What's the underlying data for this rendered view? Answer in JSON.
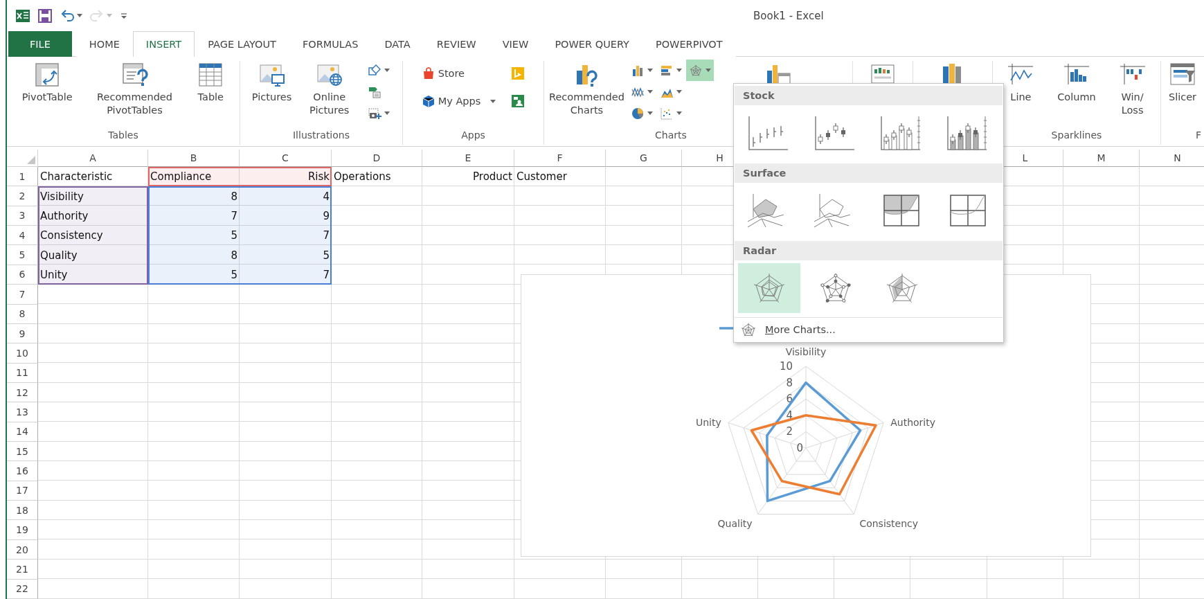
{
  "quick_access": [
    {
      "kind": "logo",
      "disabled": false,
      "caret": false
    },
    {
      "kind": "save",
      "disabled": false,
      "caret": false
    },
    {
      "kind": "undo",
      "disabled": false,
      "caret": true
    },
    {
      "kind": "redo",
      "disabled": true,
      "caret": true
    },
    {
      "kind": "customize",
      "disabled": false,
      "caret": false
    }
  ],
  "window": {
    "title": "Book1 - Excel"
  },
  "tabs": [
    {
      "label": "FILE",
      "kind": "file",
      "selected": false
    },
    {
      "label": "HOME",
      "kind": "tab",
      "selected": false
    },
    {
      "label": "INSERT",
      "kind": "tab",
      "selected": true
    },
    {
      "label": "PAGE LAYOUT",
      "kind": "tab",
      "selected": false
    },
    {
      "label": "FORMULAS",
      "kind": "tab",
      "selected": false
    },
    {
      "label": "DATA",
      "kind": "tab",
      "selected": false
    },
    {
      "label": "REVIEW",
      "kind": "tab",
      "selected": false
    },
    {
      "label": "VIEW",
      "kind": "tab",
      "selected": false
    },
    {
      "label": "POWER QUERY",
      "kind": "tab",
      "selected": false
    },
    {
      "label": "POWERPIVOT",
      "kind": "tab",
      "selected": false
    }
  ],
  "ribbon": [
    {
      "label": "Tables",
      "items": [
        {
          "kind": "pivottable",
          "label": "PivotTable"
        },
        {
          "kind": "recpivot",
          "label": "Recommended\nPivotTables"
        },
        {
          "kind": "table",
          "label": "Table"
        }
      ]
    },
    {
      "label": "Illustrations",
      "items": [
        {
          "kind": "pictures",
          "label": "Pictures"
        },
        {
          "kind": "online",
          "label": "Online\nPictures"
        },
        {
          "buttons": [
            {
              "kind": "shapes",
              "caret": true,
              "selected": false
            },
            {
              "kind": "smartart",
              "caret": false,
              "selected": false
            },
            {
              "kind": "screenshot",
              "caret": true,
              "selected": false
            }
          ]
        }
      ]
    },
    {
      "label": "Apps",
      "items": [
        {
          "buttons": [
            {
              "kind": "store",
              "label": "Store",
              "caret": false,
              "selected": false
            },
            {
              "kind": "myapps",
              "label": "My Apps",
              "caret": true,
              "selected": false
            },
            {
              "kind": "bing",
              "caret": false,
              "selected": false
            },
            {
              "kind": "people",
              "caret": false,
              "selected": false
            }
          ]
        }
      ]
    },
    {
      "label": "Charts",
      "items": [
        {
          "kind": "reccharts",
          "label": "Recommended\nCharts"
        },
        {
          "buttons": [
            {
              "kind": "col",
              "caret": true,
              "selected": false
            },
            {
              "kind": "line",
              "caret": true,
              "selected": false
            },
            {
              "kind": "pie",
              "caret": true,
              "selected": false
            },
            {
              "kind": "bar",
              "caret": true,
              "selected": false
            },
            {
              "kind": "area",
              "caret": true,
              "selected": false
            },
            {
              "kind": "scatter",
              "caret": true,
              "selected": false
            },
            {
              "kind": "radar",
              "caret": true,
              "selected": true
            }
          ]
        },
        {
          "kind": "pivotchart"
        }
      ]
    },
    {
      "items": [
        {
          "kind": "report"
        }
      ]
    },
    {
      "items": [
        {
          "kind": "map3d"
        }
      ]
    },
    {
      "label": "Sparklines",
      "items": [
        {
          "kind": "sparkline",
          "label": "Line"
        },
        {
          "kind": "sparkcol",
          "label": "Column"
        },
        {
          "kind": "winloss",
          "label": "Win/\nLoss"
        }
      ]
    },
    {
      "label": "F",
      "items": [
        {
          "kind": "slicer",
          "label": "Slicer"
        }
      ]
    }
  ],
  "sheet": {
    "columns": [
      "A",
      "B",
      "C",
      "D",
      "E",
      "F",
      "G",
      "H",
      null,
      null,
      null,
      "L",
      "M",
      "N"
    ],
    "rows": [
      {
        "header": "1",
        "cells": [
          {
            "text": "Characteristic",
            "right_aligned": false
          },
          {
            "text": "Compliance",
            "color": "#e06666",
            "right_aligned": false
          },
          {
            "text": "Risk",
            "color": "#e06666",
            "right_aligned": true
          },
          {
            "text": "Operations",
            "right_aligned": false
          },
          {
            "text": "Product",
            "right_aligned": true
          },
          {
            "text": "Customer",
            "right_aligned": false
          }
        ]
      },
      {
        "header": "2",
        "cells": [
          {
            "text": "Visibility",
            "color": "#8064a2",
            "right_aligned": false
          },
          {
            "text": "8",
            "color": "#4a7fd8",
            "right_aligned": true
          },
          {
            "text": "4",
            "color": "#4a7fd8",
            "right_aligned": true
          }
        ]
      },
      {
        "header": "3",
        "cells": [
          {
            "text": "Authority",
            "color": "#8064a2",
            "right_aligned": false
          },
          {
            "text": "7",
            "color": "#4a7fd8",
            "right_aligned": true
          },
          {
            "text": "9",
            "color": "#4a7fd8",
            "right_aligned": true
          }
        ]
      },
      {
        "header": "4",
        "cells": [
          {
            "text": "Consistency",
            "color": "#8064a2",
            "right_aligned": false
          },
          {
            "text": "5",
            "color": "#4a7fd8",
            "right_aligned": true
          },
          {
            "text": "7",
            "color": "#4a7fd8",
            "right_aligned": true
          }
        ]
      },
      {
        "header": "5",
        "cells": [
          {
            "text": "Quality",
            "color": "#8064a2",
            "right_aligned": false
          },
          {
            "text": "8",
            "color": "#4a7fd8",
            "right_aligned": true
          },
          {
            "text": "5",
            "color": "#4a7fd8",
            "right_aligned": true
          }
        ]
      },
      {
        "header": "6",
        "cells": [
          {
            "text": "Unity",
            "color": "#8064a2",
            "right_aligned": false
          },
          {
            "text": "5",
            "color": "#4a7fd8",
            "right_aligned": true
          },
          {
            "text": "7",
            "color": "#4a7fd8",
            "right_aligned": true
          }
        ]
      },
      {
        "header": "7"
      },
      {
        "header": "8"
      },
      {
        "header": "9"
      },
      {
        "header": "10"
      },
      {
        "header": "11"
      },
      {
        "header": "12"
      },
      {
        "header": "13"
      },
      {
        "header": "14"
      },
      {
        "header": "15"
      },
      {
        "header": "16"
      },
      {
        "header": "17"
      },
      {
        "header": "18"
      },
      {
        "header": "19"
      },
      {
        "header": "20"
      },
      {
        "header": "21"
      },
      {
        "header": "22"
      }
    ]
  },
  "chart": {
    "chart_data": {
      "type": "radar",
      "categories": [
        "Visibility",
        "Authority",
        "Consistency",
        "Quality",
        "Unity"
      ],
      "series": [
        {
          "color": "#5b9bd5",
          "values": [
            8,
            7,
            5,
            8,
            5
          ]
        },
        {
          "color": "#ed7d31",
          "values": [
            4,
            9,
            7,
            5,
            7
          ]
        }
      ],
      "ylim": [
        0,
        10
      ],
      "yticks": [
        0,
        2,
        4,
        6,
        8,
        10
      ]
    }
  },
  "chart_menu": {
    "sections": [
      {
        "title": "Stock",
        "items": [
          {
            "kind": "hlc",
            "selected": false
          },
          {
            "kind": "ohlc",
            "selected": false
          },
          {
            "kind": "vhlc",
            "selected": false
          },
          {
            "kind": "vohlc",
            "selected": false
          }
        ]
      },
      {
        "title": "Surface",
        "items": [
          {
            "kind": "surface",
            "selected": false
          },
          {
            "kind": "wireframe",
            "selected": false
          },
          {
            "kind": "contour",
            "selected": false
          },
          {
            "kind": "wirecontour",
            "selected": false
          }
        ]
      },
      {
        "title": "Radar",
        "items": [
          {
            "kind": "radar",
            "selected": true
          },
          {
            "kind": "radarmarkers",
            "selected": false
          },
          {
            "kind": "radarfilled",
            "selected": false
          }
        ]
      }
    ],
    "footer": {
      "label": "More Charts..."
    }
  }
}
